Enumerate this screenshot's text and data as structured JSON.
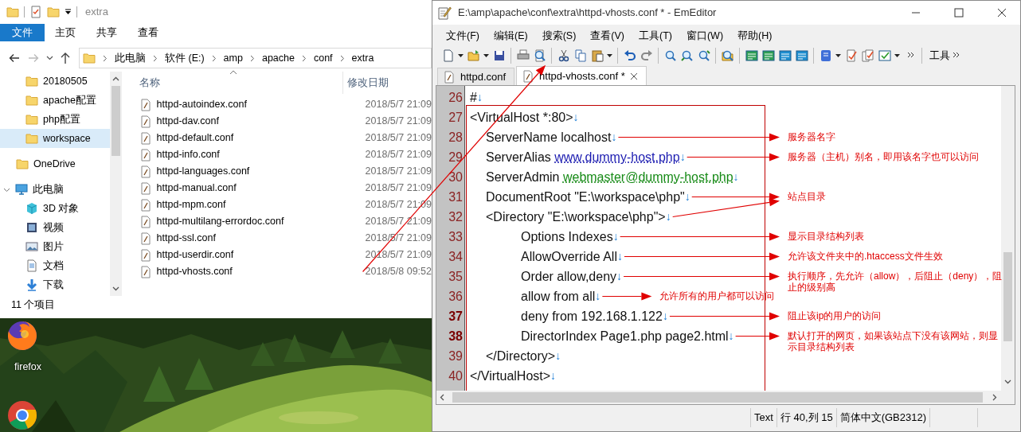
{
  "explorer": {
    "title": "extra",
    "ribbon_tabs": [
      {
        "label": "文件",
        "selected": true
      },
      {
        "label": "主页",
        "selected": false
      },
      {
        "label": "共享",
        "selected": false
      },
      {
        "label": "查看",
        "selected": false
      }
    ],
    "breadcrumb": [
      "此电脑",
      "软件 (E:)",
      "amp",
      "apache",
      "conf",
      "extra"
    ],
    "nav_items": [
      {
        "label": "20180505",
        "kind": "folder",
        "selected": false
      },
      {
        "label": "apache配置",
        "kind": "folder",
        "selected": false
      },
      {
        "label": "php配置",
        "kind": "folder",
        "selected": false
      },
      {
        "label": "workspace",
        "kind": "folder",
        "selected": true
      },
      {
        "label": "OneDrive",
        "kind": "onedrive",
        "selected": false
      },
      {
        "label": "此电脑",
        "kind": "pc",
        "selected": false,
        "expanded": true,
        "children": [
          {
            "label": "3D 对象",
            "kind": "cube",
            "selected": false
          },
          {
            "label": "视频",
            "kind": "video",
            "selected": false
          },
          {
            "label": "图片",
            "kind": "picture",
            "selected": false
          },
          {
            "label": "文档",
            "kind": "document",
            "selected": false
          },
          {
            "label": "下载",
            "kind": "download",
            "selected": false
          }
        ]
      }
    ],
    "columns": [
      "名称",
      "修改日期"
    ],
    "files": [
      {
        "name": "httpd-autoindex.conf",
        "modified": "2018/5/7 21:09"
      },
      {
        "name": "httpd-dav.conf",
        "modified": "2018/5/7 21:09"
      },
      {
        "name": "httpd-default.conf",
        "modified": "2018/5/7 21:09"
      },
      {
        "name": "httpd-info.conf",
        "modified": "2018/5/7 21:09"
      },
      {
        "name": "httpd-languages.conf",
        "modified": "2018/5/7 21:09"
      },
      {
        "name": "httpd-manual.conf",
        "modified": "2018/5/7 21:09"
      },
      {
        "name": "httpd-mpm.conf",
        "modified": "2018/5/7 21:09"
      },
      {
        "name": "httpd-multilang-errordoc.conf",
        "modified": "2018/5/7 21:09"
      },
      {
        "name": "httpd-ssl.conf",
        "modified": "2018/5/7 21:09"
      },
      {
        "name": "httpd-userdir.conf",
        "modified": "2018/5/7 21:09"
      },
      {
        "name": "httpd-vhosts.conf",
        "modified": "2018/5/8 09:52",
        "linked": true
      }
    ],
    "status": "11 个项目"
  },
  "desktop": {
    "icons": [
      {
        "kind": "firefox",
        "label": "firefox"
      },
      {
        "kind": "chrome"
      }
    ]
  },
  "editor": {
    "title": "E:\\amp\\apache\\conf\\extra\\httpd-vhosts.conf * - EmEditor",
    "menu": [
      "文件(F)",
      "编辑(E)",
      "搜索(S)",
      "查看(V)",
      "工具(T)",
      "窗口(W)",
      "帮助(H)"
    ],
    "toolbar_label": "工具",
    "tabs": [
      {
        "label": "httpd.conf",
        "selected": false
      },
      {
        "label": "httpd-vhosts.conf *",
        "selected": true
      }
    ],
    "lines": [
      {
        "number": "26",
        "text": "#",
        "eol": "↓",
        "modified": false
      },
      {
        "number": "27",
        "text": "<VirtualHost *:80>",
        "eol": "↓",
        "modified": false,
        "children": [
          {
            "number": "28",
            "text": "ServerName localhost",
            "eol": "↓",
            "modified": false,
            "note": {
              "text": "服务器名字",
              "inline": false
            }
          },
          {
            "number": "29",
            "text": "ServerAlias ",
            "link": {
              "text": "www.dummy-host.php",
              "kind": "url"
            },
            "eol": "↓",
            "modified": false,
            "note": {
              "text": "服务器（主机）别名，即用该名字也可以访问",
              "inline": false
            }
          },
          {
            "number": "30",
            "text": "ServerAdmin ",
            "link": {
              "text": "webmaster@dummy-host.php",
              "kind": "email"
            },
            "eol": "↓",
            "modified": false
          },
          {
            "number": "31",
            "text": "DocumentRoot \"E:\\workspace\\php\"",
            "eol": "↓",
            "modified": false,
            "note": {
              "text": "站点目录",
              "inline": false
            }
          },
          {
            "number": "32",
            "text": "<Directory \"E:\\workspace\\php\">",
            "eol": "↓",
            "modified": false,
            "extra_arrow": true,
            "children": [
              {
                "number": "33",
                "text": "Options Indexes",
                "eol": "↓",
                "modified": false,
                "note": {
                  "text": "显示目录结构列表",
                  "inline": false
                }
              },
              {
                "number": "34",
                "text": "AllowOverride All",
                "eol": "↓",
                "modified": false,
                "note": {
                  "text": "允许该文件夹中的.htaccess文件生效",
                  "inline": false
                }
              },
              {
                "number": "35",
                "text": "Order allow,deny",
                "eol": "↓",
                "modified": false,
                "note": {
                  "text": "执行顺序，先允许（allow），后阻止（deny），阻止的级别高",
                  "inline": false
                }
              },
              {
                "number": "36",
                "text": "allow from all",
                "eol": "↓",
                "modified": false,
                "note": {
                  "text": "允许所有的用户都可以访问",
                  "inline": true
                }
              },
              {
                "number": "37",
                "text": "deny from 192.168.1.122",
                "eol": "↓",
                "modified": true,
                "note": {
                  "text": "阻止该ip的用户的访问",
                  "inline": false
                }
              },
              {
                "number": "38",
                "text": "DirectorIndex Page1.php page2.html",
                "eol": "↓",
                "modified": true,
                "note": {
                  "text": "默认打开的网页，如果该站点下没有该网站，则显示目录结构列表",
                  "inline": false
                }
              }
            ]
          },
          {
            "number": "39",
            "text": "</Directory>",
            "eol": "↓",
            "modified": false
          }
        ]
      },
      {
        "number": "40",
        "text": "</VirtualHost>",
        "eol": "↓",
        "modified": false
      }
    ],
    "status_bar": [
      "Text",
      "行 40,列 15",
      "简体中文(GB2312)"
    ]
  }
}
